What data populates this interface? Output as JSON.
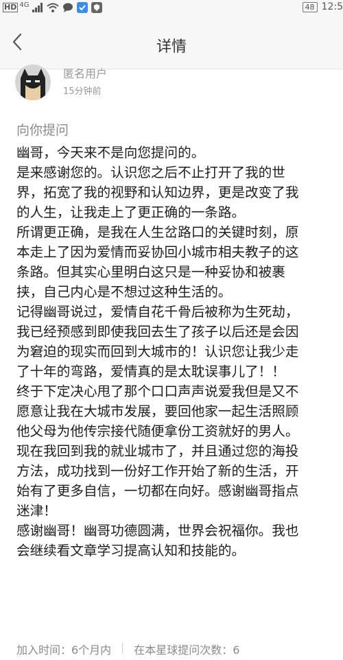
{
  "status_bar": {
    "hd": "HD",
    "network": "4G",
    "battery": "48",
    "time": "12:5"
  },
  "header": {
    "title": "详情"
  },
  "user": {
    "name": "匿名用户",
    "time": "15分钟前"
  },
  "question_label": "向你提问",
  "content_lines": [
    "幽哥，今天来不是向您提问的。",
    "是来感谢您的。认识您之后不止打开了我的世",
    "界，拓宽了我的视野和认知边界，更是改变了我",
    "的人生，让我走上了更正确的一条路。",
    "所谓更正确，是我在人生岔路口的关键时刻，原",
    "本走上了因为爱情而妥协回小城市相夫教子的这",
    "条路。但其实心里明白这只是一种妥协和被裹",
    "挟，自己内心是不想过这种生活的。",
    "记得幽哥说过，爱情自花千骨后被称为生死劫，",
    "我已经预感到即使我回去生了孩子以后还是会因",
    "为窘迫的现实而回到大城市的！认识您让我少走",
    "了十年的弯路，爱情真的是太耽误事儿了！！",
    "终于下定决心甩了那个口口声声说爱我但是又不",
    "愿意让我在大城市发展，要回他家一起生活照顾",
    "他父母为他传宗接代随便拿份工资就好的男人。",
    "现在我回到我的就业城市了，并且通过您的海投",
    "方法，成功找到一份好工作开始了新的生活，开",
    "始有了更多自信，一切都在向好。感谢幽哥指点",
    "迷津！",
    "感谢幽哥！幽哥功德圆满，世界会祝福你。我也",
    "会继续看文章学习提高认知和技能的。"
  ],
  "footer": {
    "join_time": "加入时间：6个月内",
    "question_count": "在本星球提问次数：6"
  }
}
